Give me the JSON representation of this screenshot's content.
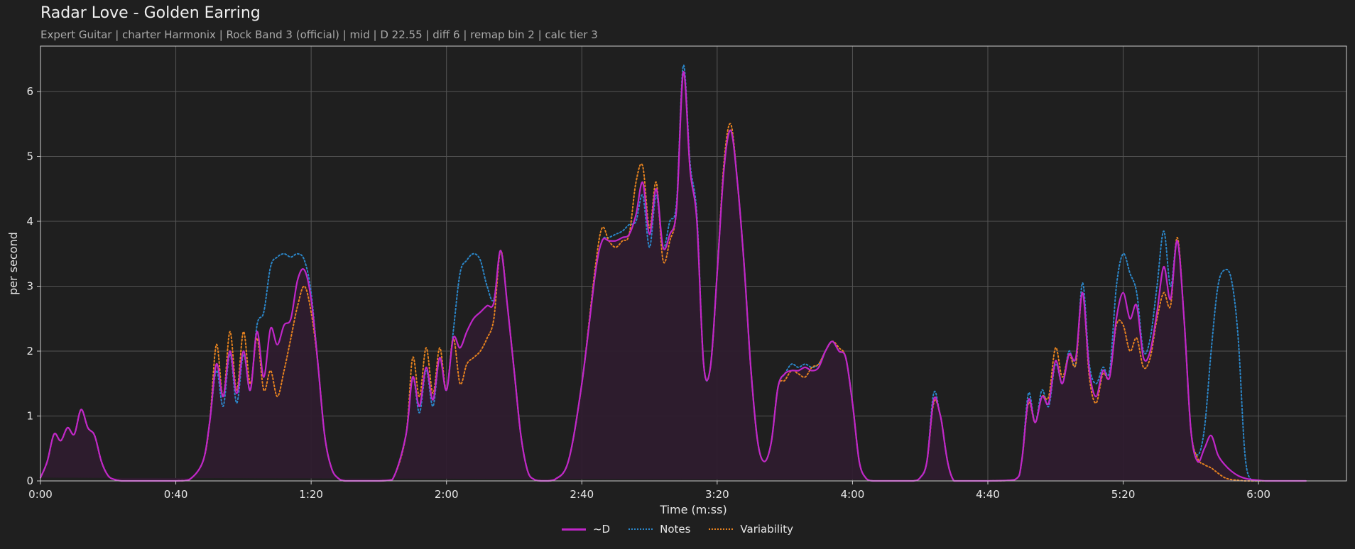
{
  "header": {
    "title": "Radar Love - Golden Earring",
    "subtitle": "Expert Guitar  |  charter Harmonix  |  Rock Band 3 (official)  |  mid  |  D 22.55  |  diff 6  |  remap bin 2  |  calc tier 3"
  },
  "colors": {
    "background": "#1f1f1f",
    "plot_background": "#1f1f1f",
    "grid": "#555555",
    "difficulty": "#c026c8",
    "notes": "#2b86c8",
    "variability": "#e6821f",
    "fill": "#2e1c2e"
  },
  "chart_data": {
    "type": "line",
    "xlabel": "Time (m:ss)",
    "ylabel": "per second",
    "xlim": [
      0,
      386
    ],
    "ylim": [
      0,
      6.7
    ],
    "x_ticks": [
      0,
      40,
      80,
      120,
      160,
      200,
      240,
      280,
      320,
      360
    ],
    "x_tick_labels": [
      "0:00",
      "0:40",
      "1:20",
      "2:00",
      "2:40",
      "3:20",
      "4:00",
      "4:40",
      "5:20",
      "6:00"
    ],
    "y_ticks": [
      0,
      1,
      2,
      3,
      4,
      5,
      6
    ],
    "y_tick_labels": [
      "0",
      "1",
      "2",
      "3",
      "4",
      "5",
      "6"
    ],
    "grid": true,
    "legend_position": "bottom-center",
    "x": [
      0,
      2,
      4,
      6,
      8,
      10,
      12,
      14,
      16,
      18,
      20,
      22,
      24,
      26,
      28,
      30,
      40,
      44,
      48,
      50,
      52,
      54,
      56,
      58,
      60,
      62,
      64,
      66,
      68,
      70,
      72,
      74,
      76,
      78,
      80,
      82,
      84,
      86,
      88,
      90,
      92,
      94,
      96,
      98,
      100,
      104,
      108,
      110,
      112,
      114,
      116,
      118,
      120,
      122,
      124,
      126,
      128,
      130,
      132,
      134,
      136,
      138,
      140,
      142,
      144,
      146,
      148,
      150,
      152,
      156,
      160,
      164,
      166,
      168,
      170,
      172,
      174,
      176,
      178,
      180,
      182,
      184,
      186,
      188,
      190,
      192,
      194,
      196,
      198,
      200,
      202,
      204,
      206,
      208,
      210,
      212,
      214,
      216,
      218,
      220,
      222,
      224,
      226,
      228,
      230,
      232,
      234,
      236,
      238,
      240,
      242,
      244,
      246,
      248,
      250,
      252,
      254,
      256,
      258,
      260,
      262,
      264,
      266,
      270,
      280,
      288,
      290,
      292,
      294,
      296,
      298,
      300,
      302,
      304,
      306,
      308,
      310,
      312,
      314,
      316,
      318,
      320,
      322,
      324,
      326,
      328,
      330,
      332,
      334,
      336,
      338,
      340,
      342,
      344,
      346,
      348,
      350,
      352,
      354,
      356,
      358,
      360,
      362,
      364,
      366,
      368,
      370,
      372,
      374,
      376,
      378,
      380,
      382,
      384,
      386
    ],
    "series": [
      {
        "name": "~D",
        "values": [
          0.05,
          0.3,
          0.72,
          0.62,
          0.82,
          0.72,
          1.1,
          0.82,
          0.7,
          0.3,
          0.08,
          0.02,
          0,
          0,
          0,
          0,
          0,
          0.02,
          0.3,
          0.9,
          1.8,
          1.3,
          2.0,
          1.35,
          2.0,
          1.4,
          2.3,
          1.6,
          2.35,
          2.1,
          2.4,
          2.5,
          3.1,
          3.25,
          2.8,
          1.8,
          0.7,
          0.2,
          0.04,
          0,
          0,
          0,
          0,
          0,
          0,
          0.02,
          0.7,
          1.6,
          1.15,
          1.75,
          1.25,
          1.9,
          1.4,
          2.2,
          2.05,
          2.3,
          2.5,
          2.6,
          2.7,
          2.75,
          3.55,
          2.7,
          1.7,
          0.7,
          0.15,
          0.02,
          0,
          0,
          0.02,
          0.3,
          1.5,
          3.2,
          3.7,
          3.7,
          3.7,
          3.75,
          3.8,
          4.1,
          4.6,
          3.8,
          4.5,
          3.6,
          3.8,
          4.2,
          6.3,
          4.8,
          4.0,
          1.8,
          1.75,
          3.2,
          4.8,
          5.4,
          4.6,
          3.3,
          1.7,
          0.6,
          0.3,
          0.6,
          1.45,
          1.65,
          1.7,
          1.7,
          1.75,
          1.7,
          1.75,
          2.0,
          2.15,
          2.0,
          1.9,
          1.2,
          0.3,
          0.04,
          0,
          0,
          0,
          0,
          0,
          0,
          0,
          0.05,
          0.3,
          1.25,
          1.0,
          0,
          0,
          0.02,
          0.3,
          1.25,
          0.9,
          1.3,
          1.2,
          1.85,
          1.5,
          1.95,
          1.9,
          2.9,
          1.7,
          1.3,
          1.7,
          1.6,
          2.5,
          2.9,
          2.5,
          2.7,
          1.9,
          2.0,
          2.6,
          3.3,
          2.8,
          3.7,
          2.5,
          0.8,
          0.3,
          0.5,
          0.7,
          0.4,
          0.25,
          0.15,
          0.08,
          0.04,
          0.02,
          0.01,
          0,
          0,
          0,
          0,
          0,
          0,
          0,
          0
        ]
      },
      {
        "name": "Notes",
        "values": [
          0.05,
          0.3,
          0.72,
          0.62,
          0.82,
          0.72,
          1.1,
          0.82,
          0.7,
          0.3,
          0.08,
          0.02,
          0,
          0,
          0,
          0,
          0,
          0.02,
          0.3,
          0.9,
          1.7,
          1.15,
          1.95,
          1.2,
          1.95,
          1.4,
          2.4,
          2.6,
          3.3,
          3.45,
          3.5,
          3.45,
          3.5,
          3.4,
          2.9,
          1.8,
          0.7,
          0.2,
          0.04,
          0,
          0,
          0,
          0,
          0,
          0,
          0.02,
          0.7,
          1.6,
          1.05,
          1.7,
          1.15,
          1.9,
          1.4,
          2.3,
          3.2,
          3.4,
          3.5,
          3.4,
          3.0,
          2.8,
          3.55,
          2.7,
          1.7,
          0.7,
          0.15,
          0.02,
          0,
          0,
          0.02,
          0.3,
          1.5,
          3.2,
          3.7,
          3.75,
          3.8,
          3.85,
          3.95,
          4.0,
          4.4,
          3.6,
          4.4,
          3.6,
          4.0,
          4.3,
          6.4,
          4.9,
          4.1,
          1.8,
          1.75,
          3.2,
          4.8,
          5.4,
          4.6,
          3.3,
          1.7,
          0.6,
          0.3,
          0.6,
          1.45,
          1.65,
          1.8,
          1.75,
          1.8,
          1.75,
          1.8,
          2.0,
          2.15,
          2.0,
          1.9,
          1.2,
          0.3,
          0.04,
          0,
          0,
          0,
          0,
          0,
          0,
          0,
          0.05,
          0.3,
          1.35,
          1.0,
          0,
          0,
          0.02,
          0.3,
          1.35,
          0.9,
          1.4,
          1.15,
          1.8,
          1.5,
          2.0,
          1.8,
          3.05,
          1.8,
          1.5,
          1.75,
          1.7,
          3.0,
          3.5,
          3.2,
          2.9,
          2.0,
          2.2,
          3.0,
          3.85,
          3.0,
          3.7,
          2.5,
          0.8,
          0.4,
          0.8,
          2.0,
          3.0,
          3.25,
          3.1,
          2.2,
          0.4,
          0,
          0,
          0,
          0,
          0,
          0,
          0,
          0,
          0,
          0
        ]
      },
      {
        "name": "Variability",
        "values": [
          0.05,
          0.3,
          0.72,
          0.62,
          0.82,
          0.72,
          1.1,
          0.82,
          0.7,
          0.3,
          0.08,
          0.02,
          0,
          0,
          0,
          0,
          0,
          0.02,
          0.3,
          0.9,
          2.1,
          1.3,
          2.3,
          1.4,
          2.3,
          1.5,
          2.2,
          1.4,
          1.7,
          1.3,
          1.7,
          2.2,
          2.7,
          3.0,
          2.6,
          1.8,
          0.7,
          0.2,
          0.04,
          0,
          0,
          0,
          0,
          0,
          0,
          0.02,
          0.7,
          1.9,
          1.3,
          2.05,
          1.35,
          2.05,
          1.4,
          2.2,
          1.5,
          1.8,
          1.9,
          2.0,
          2.2,
          2.5,
          3.55,
          2.7,
          1.7,
          0.7,
          0.15,
          0.02,
          0,
          0,
          0.02,
          0.3,
          1.5,
          3.3,
          3.9,
          3.7,
          3.6,
          3.7,
          3.8,
          4.6,
          4.85,
          3.9,
          4.6,
          3.4,
          3.7,
          4.2,
          6.3,
          4.8,
          4.0,
          1.8,
          1.75,
          3.2,
          4.9,
          5.5,
          4.6,
          3.3,
          1.7,
          0.6,
          0.3,
          0.6,
          1.45,
          1.55,
          1.7,
          1.65,
          1.6,
          1.75,
          1.8,
          2.0,
          2.15,
          2.05,
          1.9,
          1.2,
          0.3,
          0.04,
          0,
          0,
          0,
          0,
          0,
          0,
          0,
          0.05,
          0.3,
          1.2,
          1.0,
          0,
          0,
          0.02,
          0.3,
          1.2,
          0.9,
          1.3,
          1.3,
          2.05,
          1.6,
          1.95,
          1.8,
          2.9,
          1.6,
          1.2,
          1.65,
          1.6,
          2.4,
          2.4,
          2.0,
          2.2,
          1.75,
          1.9,
          2.5,
          2.9,
          2.7,
          3.75,
          2.5,
          0.8,
          0.35,
          0.25,
          0.2,
          0.12,
          0.05,
          0.02,
          0.01,
          0,
          0,
          0,
          0,
          0,
          0,
          0,
          0,
          0,
          0,
          0
        ]
      }
    ]
  }
}
